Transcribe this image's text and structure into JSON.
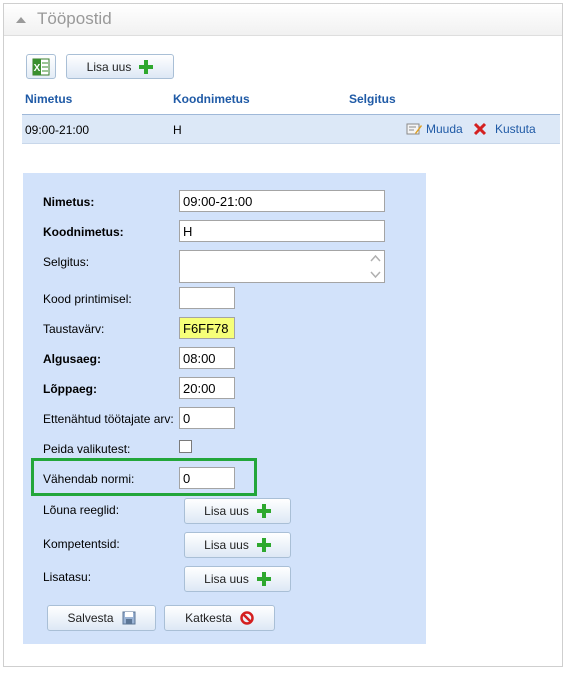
{
  "panel": {
    "title": "Tööpostid"
  },
  "toolbar": {
    "add_label": "Lisa uus"
  },
  "grid": {
    "columns": [
      "Nimetus",
      "Koodnimetus",
      "Selgitus"
    ],
    "rows": [
      {
        "name": "09:00-21:00",
        "code": "H",
        "description": "",
        "edit_label": "Muuda",
        "delete_label": "Kustuta"
      }
    ]
  },
  "form": {
    "fields": {
      "name": {
        "label": "Nimetus:",
        "value": "09:00-21:00"
      },
      "code": {
        "label": "Koodnimetus:",
        "value": "H"
      },
      "description": {
        "label": "Selgitus:",
        "value": ""
      },
      "print_code": {
        "label": "Kood printimisel:",
        "value": ""
      },
      "bg_color": {
        "label": "Taustavärv:",
        "value": "F6FF78",
        "color": "#F6FF78"
      },
      "start_time": {
        "label": "Algusaeg:",
        "value": "08:00"
      },
      "end_time": {
        "label": "Lõppaeg:",
        "value": "20:00"
      },
      "planned_workers": {
        "label": "Ettenähtud töötajate arv:",
        "value": "0"
      },
      "hide_from_selection": {
        "label": "Peida valikutest:",
        "checked": false
      },
      "reduces_norm": {
        "label": "Vähendab normi:",
        "value": "0"
      }
    },
    "lunch_rules": {
      "label": "Lõuna reeglid:",
      "button": "Lisa uus"
    },
    "competences": {
      "label": "Kompetentsid:",
      "button": "Lisa uus"
    },
    "surcharge": {
      "label": "Lisatasu:",
      "button": "Lisa uus"
    },
    "save_label": "Salvesta",
    "cancel_label": "Katkesta"
  },
  "colors": {
    "header_text": "#1f5aa6",
    "form_bg": "#d2e2fa",
    "highlight": "#22a63a",
    "row_bg": "#dce8f7"
  }
}
